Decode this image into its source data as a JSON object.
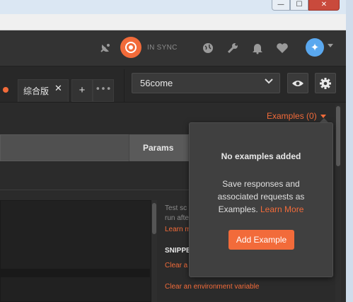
{
  "header": {
    "sync_status": "IN SYNC",
    "icons": [
      "satellite-icon",
      "sync-icon",
      "globe-icon",
      "wrench-icon",
      "bell-icon",
      "heart-icon",
      "avatar"
    ]
  },
  "window": {
    "minimize_glyph": "—",
    "maximize_glyph": "☐",
    "close_glyph": "✕"
  },
  "tabs": {
    "active_label": "综合版",
    "close_glyph": "✕",
    "add_glyph": "+",
    "more_glyph": "•••"
  },
  "environment": {
    "selected": "56come",
    "chevron": "⌄"
  },
  "request": {
    "examples_label": "Examples (0)",
    "params_label": "Params"
  },
  "sidebar": {
    "test_text": "Test sc",
    "run_text": "run afte",
    "learn_text": "Learn m",
    "snippets_heading": "SNIPPE",
    "snippet_1": "Clear a",
    "snippet_2": "Clear an environment variable"
  },
  "popover": {
    "title": "No examples added",
    "body_line_1": "Save responses and",
    "body_line_2": "associated requests as",
    "body_line_3": "Examples.",
    "learn_more": "Learn More",
    "button_label": "Add Example"
  },
  "colors": {
    "accent": "#f26b3a",
    "background": "#2b2b2b",
    "header": "#333333",
    "avatar": "#5aa8ef"
  }
}
